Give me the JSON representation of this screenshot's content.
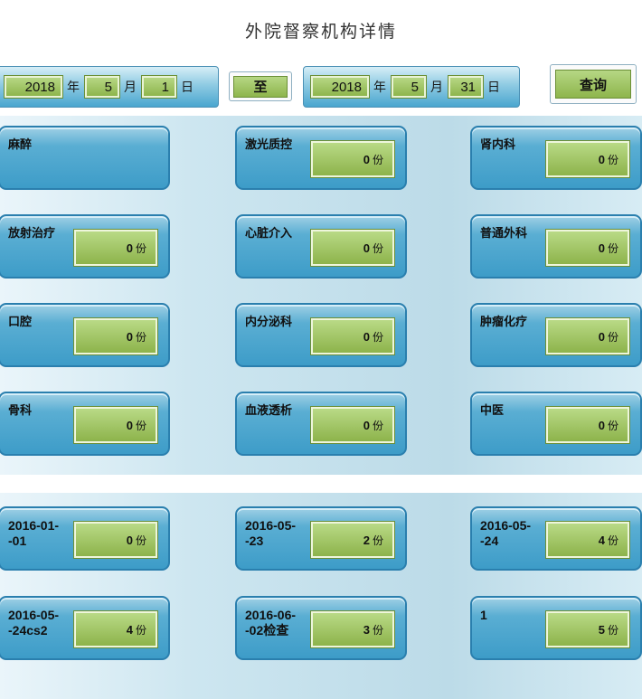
{
  "page_title": "外院督察机构详情",
  "filter": {
    "start": {
      "year": "2018",
      "year_unit": "年",
      "month": "5",
      "month_unit": "月",
      "day": "1",
      "day_unit": "日"
    },
    "to_label": "至",
    "end": {
      "year": "2018",
      "year_unit": "年",
      "month": "5",
      "month_unit": "月",
      "day": "31",
      "day_unit": "日"
    },
    "query_label": "查询"
  },
  "unit": "份",
  "departments": [
    {
      "name": "麻醉",
      "count": ""
    },
    {
      "name": "激光质控",
      "count": "0"
    },
    {
      "name": "肾内科",
      "count": "0"
    },
    {
      "name": "放射治疗",
      "count": "0"
    },
    {
      "name": "心脏介入",
      "count": "0"
    },
    {
      "name": "普通外科",
      "count": "0"
    },
    {
      "name": "口腔",
      "count": "0"
    },
    {
      "name": "内分泌科",
      "count": "0"
    },
    {
      "name": "肿瘤化疗",
      "count": "0"
    },
    {
      "name": "骨科",
      "count": "0"
    },
    {
      "name": "血液透析",
      "count": "0"
    },
    {
      "name": "中医",
      "count": "0"
    }
  ],
  "records": [
    {
      "name": "2016-01-\n-01",
      "count": "0"
    },
    {
      "name": "2016-05-\n-23",
      "count": "2"
    },
    {
      "name": "2016-05-\n-24",
      "count": "4"
    },
    {
      "name": "2016-05-\n-24cs2",
      "count": "4"
    },
    {
      "name": "2016-06-\n-02检查",
      "count": "3"
    },
    {
      "name": "1",
      "count": "5"
    }
  ]
}
